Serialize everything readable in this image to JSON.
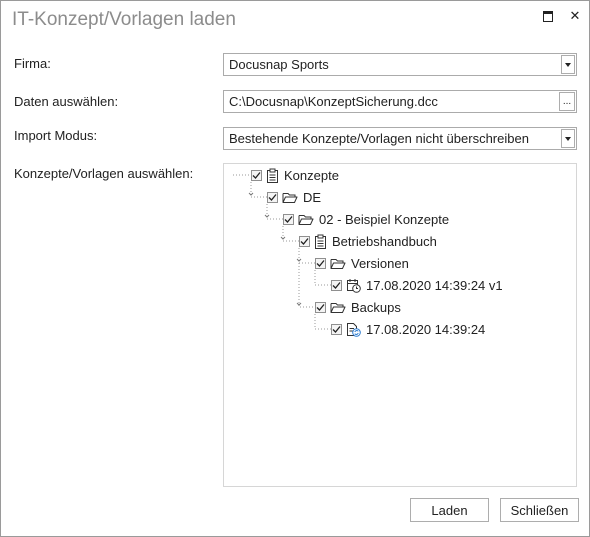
{
  "window": {
    "title": "IT-Konzept/Vorlagen laden",
    "close_glyph": "✕"
  },
  "form": {
    "firma": {
      "label": "Firma:",
      "value": "Docusnap Sports"
    },
    "daten": {
      "label": "Daten auswählen:",
      "value": "C:\\Docusnap\\KonzeptSicherung.dcc",
      "browse": "..."
    },
    "modus": {
      "label": "Import Modus:",
      "value": "Bestehende Konzepte/Vorlagen nicht überschreiben"
    },
    "konzepte": {
      "label": "Konzepte/Vorlagen auswählen:"
    }
  },
  "tree": [
    {
      "label": "Konzepte",
      "icon": "clipboard-icon",
      "checked": true
    },
    {
      "label": "DE",
      "icon": "folder-open-icon",
      "checked": true
    },
    {
      "label": "02 - Beispiel Konzepte",
      "icon": "folder-open-icon",
      "checked": true
    },
    {
      "label": "Betriebshandbuch",
      "icon": "clipboard-icon",
      "checked": true
    },
    {
      "label": "Versionen",
      "icon": "folder-open-icon",
      "checked": true
    },
    {
      "label": "17.08.2020 14:39:24 v1",
      "icon": "calendar-clock-icon",
      "checked": true
    },
    {
      "label": "Backups",
      "icon": "folder-open-icon",
      "checked": true
    },
    {
      "label": "17.08.2020 14:39:24",
      "icon": "document-refresh-icon",
      "checked": true
    }
  ],
  "buttons": {
    "load": "Laden",
    "close": "Schließen"
  },
  "colors": {
    "title": "#8c8c8c",
    "border": "#ababab",
    "refresh_accent": "#2a7bd1"
  }
}
